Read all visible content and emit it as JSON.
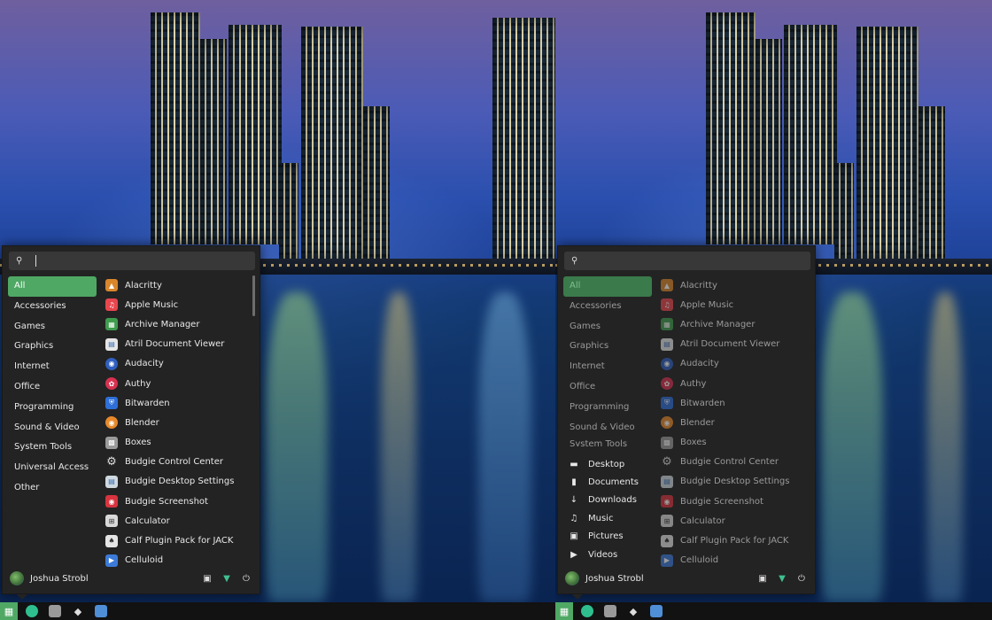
{
  "search": {
    "placeholder": ""
  },
  "categories": [
    "All",
    "Accessories",
    "Games",
    "Graphics",
    "Internet",
    "Office",
    "Programming",
    "Sound & Video",
    "System Tools",
    "Universal Access",
    "Other"
  ],
  "apps": [
    {
      "label": "Alacritty",
      "icon": "alacritty-icon",
      "color": "#d9862b"
    },
    {
      "label": "Apple Music",
      "icon": "apple-music-icon",
      "color": "#e8464e"
    },
    {
      "label": "Archive Manager",
      "icon": "archive-manager-icon",
      "color": "#3f9c4d"
    },
    {
      "label": "Atril Document Viewer",
      "icon": "atril-icon",
      "color": "#e5e5e5"
    },
    {
      "label": "Audacity",
      "icon": "audacity-icon",
      "color": "#2f5fbf"
    },
    {
      "label": "Authy",
      "icon": "authy-icon",
      "color": "#d8314f"
    },
    {
      "label": "Bitwarden",
      "icon": "bitwarden-icon",
      "color": "#2e6fd8"
    },
    {
      "label": "Blender",
      "icon": "blender-icon",
      "color": "#e8892b"
    },
    {
      "label": "Boxes",
      "icon": "boxes-icon",
      "color": "#9a9a9a"
    },
    {
      "label": "Budgie Control Center",
      "icon": "control-center-icon",
      "color": "#bdbdbd"
    },
    {
      "label": "Budgie Desktop Settings",
      "icon": "desktop-settings-icon",
      "color": "#cfd8df"
    },
    {
      "label": "Budgie Screenshot",
      "icon": "screenshot-icon",
      "color": "#d8343f"
    },
    {
      "label": "Calculator",
      "icon": "calculator-icon",
      "color": "#d9d9d9"
    },
    {
      "label": "Calf Plugin Pack for JACK",
      "icon": "calf-icon",
      "color": "#e5e5e5"
    },
    {
      "label": "Celluloid",
      "icon": "celluloid-icon",
      "color": "#3c7ad8"
    }
  ],
  "places": [
    {
      "label": "Desktop",
      "icon": "desktop-icon"
    },
    {
      "label": "Documents",
      "icon": "documents-icon"
    },
    {
      "label": "Downloads",
      "icon": "downloads-icon"
    },
    {
      "label": "Music",
      "icon": "music-icon"
    },
    {
      "label": "Pictures",
      "icon": "pictures-icon"
    },
    {
      "label": "Videos",
      "icon": "videos-icon"
    }
  ],
  "user": {
    "name": "Joshua Strobl"
  },
  "colors": {
    "accent": "#4fa864",
    "menu_bg": "#232323",
    "panel_bg": "#121212"
  }
}
